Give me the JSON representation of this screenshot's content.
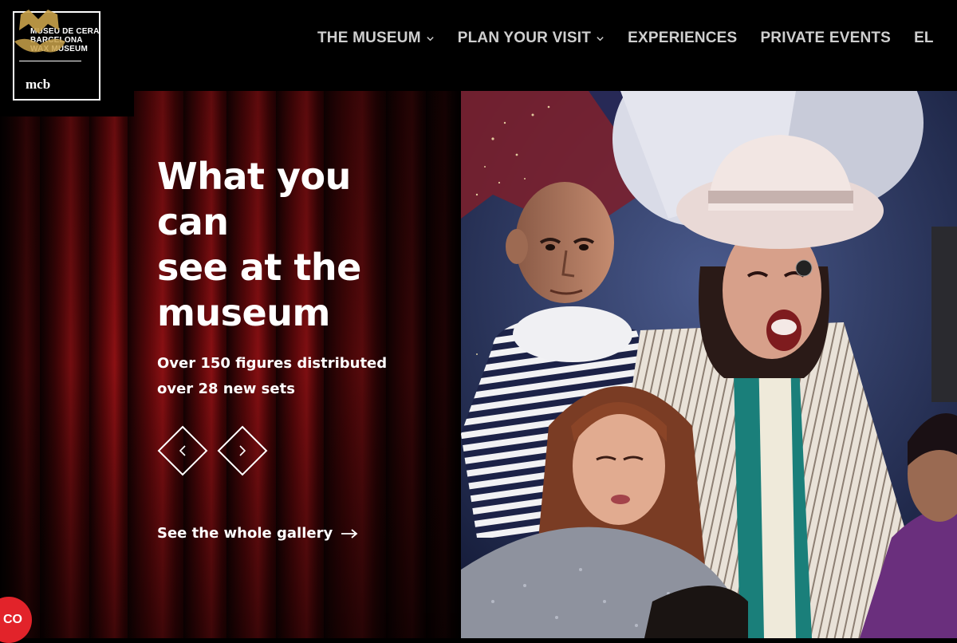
{
  "brand": {
    "name_lines": [
      "MUSEU DE CERA",
      "BARCELONA",
      "WAX MUSEUM"
    ],
    "short": "mcb",
    "accent_gold": "#c9a24a"
  },
  "nav": {
    "items": [
      {
        "label": "THE MUSEUM",
        "has_dropdown": true
      },
      {
        "label": "PLAN YOUR VISIT",
        "has_dropdown": true
      },
      {
        "label": "EXPERIENCES",
        "has_dropdown": false
      },
      {
        "label": "PRIVATE EVENTS",
        "has_dropdown": false
      },
      {
        "label": "EL",
        "has_dropdown": false
      }
    ]
  },
  "hero": {
    "title_lines": [
      "What you",
      "can",
      "see at the",
      "museum"
    ],
    "subtitle_lines": [
      "Over 150 figures distributed",
      "over 28 new sets"
    ],
    "prev_icon": "chevron-left-icon",
    "next_icon": "chevron-right-icon",
    "gallery_link": "See the whole gallery",
    "gallery_icon": "arrow-right-icon"
  },
  "chat_badge": {
    "label": "CO",
    "color": "#e2232a"
  },
  "colors": {
    "background": "#000000",
    "curtain_red": "#8a0d10",
    "nav_text": "#cfcfcf"
  }
}
